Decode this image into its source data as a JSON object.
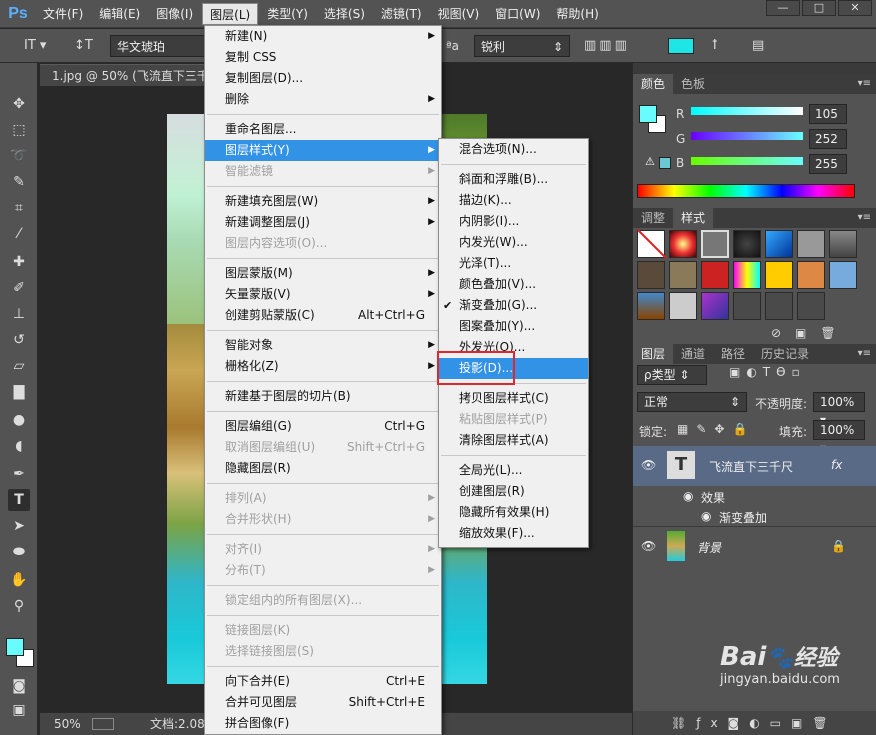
{
  "app": {
    "logo": "Ps"
  },
  "menubar": [
    "文件(F)",
    "编辑(E)",
    "图像(I)",
    "图层(L)",
    "类型(Y)",
    "选择(S)",
    "滤镜(T)",
    "视图(V)",
    "窗口(W)",
    "帮助(H)"
  ],
  "window": {
    "min": "—",
    "max": "□",
    "close": "✕"
  },
  "options": {
    "font_family": "华文琥珀",
    "aa_label": "ªa",
    "aa_value": "锐利",
    "text_color": "#1ee6e6"
  },
  "document": {
    "tab": "1.jpg @ 50% (飞流直下三千",
    "zoom": "50%",
    "doc_info": "文档:2.08"
  },
  "layer_menu": [
    {
      "label": "新建(N)",
      "arrow": true
    },
    {
      "label": "复制 CSS"
    },
    {
      "label": "复制图层(D)..."
    },
    {
      "label": "删除",
      "arrow": true
    },
    {
      "sep": true
    },
    {
      "label": "重命名图层..."
    },
    {
      "label": "图层样式(Y)",
      "arrow": true,
      "hl": true
    },
    {
      "label": "智能滤镜",
      "dis": true,
      "arrow": true
    },
    {
      "sep": true
    },
    {
      "label": "新建填充图层(W)",
      "arrow": true
    },
    {
      "label": "新建调整图层(J)",
      "arrow": true
    },
    {
      "label": "图层内容选项(O)...",
      "dis": true
    },
    {
      "sep": true
    },
    {
      "label": "图层蒙版(M)",
      "arrow": true
    },
    {
      "label": "矢量蒙版(V)",
      "arrow": true
    },
    {
      "label": "创建剪贴蒙版(C)",
      "sc": "Alt+Ctrl+G"
    },
    {
      "sep": true
    },
    {
      "label": "智能对象",
      "arrow": true
    },
    {
      "label": "栅格化(Z)",
      "arrow": true
    },
    {
      "sep": true
    },
    {
      "label": "新建基于图层的切片(B)"
    },
    {
      "sep": true
    },
    {
      "label": "图层编组(G)",
      "sc": "Ctrl+G"
    },
    {
      "label": "取消图层编组(U)",
      "sc": "Shift+Ctrl+G",
      "dis": true
    },
    {
      "label": "隐藏图层(R)"
    },
    {
      "sep": true
    },
    {
      "label": "排列(A)",
      "arrow": true,
      "dis": true
    },
    {
      "label": "合并形状(H)",
      "arrow": true,
      "dis": true
    },
    {
      "sep": true
    },
    {
      "label": "对齐(I)",
      "arrow": true,
      "dis": true
    },
    {
      "label": "分布(T)",
      "arrow": true,
      "dis": true
    },
    {
      "sep": true
    },
    {
      "label": "锁定组内的所有图层(X)...",
      "dis": true
    },
    {
      "sep": true
    },
    {
      "label": "链接图层(K)",
      "dis": true
    },
    {
      "label": "选择链接图层(S)",
      "dis": true
    },
    {
      "sep": true
    },
    {
      "label": "向下合并(E)",
      "sc": "Ctrl+E"
    },
    {
      "label": "合并可见图层",
      "sc": "Shift+Ctrl+E"
    },
    {
      "label": "拼合图像(F)"
    }
  ],
  "style_menu": [
    {
      "label": "混合选项(N)..."
    },
    {
      "sep": true
    },
    {
      "label": "斜面和浮雕(B)..."
    },
    {
      "label": "描边(K)..."
    },
    {
      "label": "内阴影(I)..."
    },
    {
      "label": "内发光(W)..."
    },
    {
      "label": "光泽(T)..."
    },
    {
      "label": "颜色叠加(V)..."
    },
    {
      "label": "渐变叠加(G)...",
      "chk": true
    },
    {
      "label": "图案叠加(Y)..."
    },
    {
      "label": "外发光(O)..."
    },
    {
      "label": "投影(D)...",
      "hl": true
    },
    {
      "sep": true
    },
    {
      "label": "拷贝图层样式(C)"
    },
    {
      "label": "粘贴图层样式(P)",
      "dis": true
    },
    {
      "label": "清除图层样式(A)"
    },
    {
      "sep": true
    },
    {
      "label": "全局光(L)..."
    },
    {
      "label": "创建图层(R)"
    },
    {
      "label": "隐藏所有效果(H)"
    },
    {
      "label": "缩放效果(F)..."
    }
  ],
  "color_panel": {
    "tabs": [
      "颜色",
      "色板"
    ],
    "r_label": "R",
    "g_label": "G",
    "b_label": "B",
    "r": "105",
    "g": "252",
    "b": "255",
    "fg": "#69fcff",
    "bg": "#ffffff"
  },
  "styles_panel": {
    "tabs": [
      "调整",
      "样式"
    ]
  },
  "layers_panel": {
    "tabs": [
      "图层",
      "通道",
      "路径",
      "历史记录"
    ],
    "kind": "ρ类型",
    "blend": "正常",
    "opacity_label": "不透明度:",
    "opacity": "100%",
    "lock_label": "锁定:",
    "fill_label": "填充:",
    "fill": "100%",
    "layer1": "飞流直下三千尺",
    "effects": "效果",
    "effect1": "渐变叠加",
    "layer2": "背景",
    "fx": "fx"
  },
  "watermark": {
    "brand": "Bai",
    "brand2": "经验",
    "url": "jingyan.baidu.com"
  }
}
